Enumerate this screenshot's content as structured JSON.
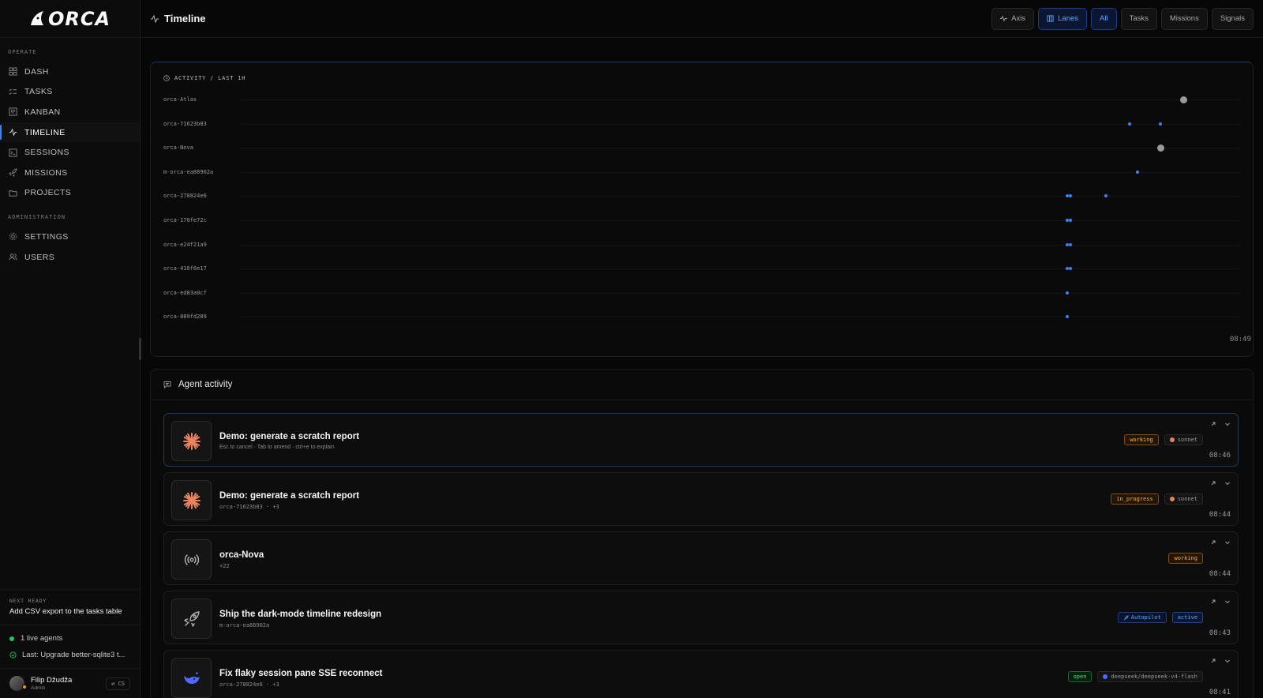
{
  "brand": {
    "logo_text": "ORCA",
    "accent": "#3b82f6"
  },
  "sidebar": {
    "sections": [
      {
        "label": "OPERATE",
        "items": [
          {
            "label": "DASH",
            "icon": "grid-icon"
          },
          {
            "label": "TASKS",
            "icon": "checklist-icon"
          },
          {
            "label": "KANBAN",
            "icon": "kanban-icon"
          },
          {
            "label": "TIMELINE",
            "icon": "activity-icon",
            "active": true
          },
          {
            "label": "SESSIONS",
            "icon": "terminal-icon"
          },
          {
            "label": "MISSIONS",
            "icon": "rocket-icon"
          },
          {
            "label": "PROJECTS",
            "icon": "folder-icon"
          }
        ]
      },
      {
        "label": "ADMINISTRATION",
        "items": [
          {
            "label": "SETTINGS",
            "icon": "gear-icon"
          },
          {
            "label": "USERS",
            "icon": "users-icon"
          }
        ]
      }
    ],
    "next_ready": {
      "label": "NEXT READY",
      "title": "Add CSV export to the tasks table"
    },
    "status": {
      "live_agents": "1 live agents",
      "last": "Last: Upgrade better-sqlite3 t..."
    },
    "user": {
      "name": "Filip Džudža",
      "role": "Admin",
      "lang": "CS"
    }
  },
  "header": {
    "title": "Timeline",
    "toolbar": [
      {
        "label": "Axis",
        "icon": "activity-icon",
        "active": false
      },
      {
        "label": "Lanes",
        "icon": "columns-icon",
        "active": true
      },
      {
        "label": "All",
        "active": true
      },
      {
        "label": "Tasks",
        "active": false
      },
      {
        "label": "Missions",
        "active": false
      },
      {
        "label": "Signals",
        "active": false
      }
    ]
  },
  "activity": {
    "title": "ACTIVITY / LAST 1H",
    "end_time": "08:49",
    "lanes": [
      {
        "name": "orca-Atlas",
        "events": [
          {
            "t": 0.942,
            "big": true
          }
        ]
      },
      {
        "name": "orca-71623b83",
        "events": [
          {
            "t": 0.888
          },
          {
            "t": 0.919
          }
        ]
      },
      {
        "name": "orca-Nova",
        "events": [
          {
            "t": 0.919,
            "big": true
          }
        ]
      },
      {
        "name": "m-orca-ea88902a",
        "events": [
          {
            "t": 0.896
          }
        ]
      },
      {
        "name": "orca-278824e6",
        "events": [
          {
            "t": 0.826
          },
          {
            "t": 0.829
          },
          {
            "t": 0.864
          }
        ]
      },
      {
        "name": "orca-170fe72c",
        "events": [
          {
            "t": 0.826
          },
          {
            "t": 0.829
          }
        ]
      },
      {
        "name": "orca-e24f21a9",
        "events": [
          {
            "t": 0.826
          },
          {
            "t": 0.829
          }
        ]
      },
      {
        "name": "orca-410f6e17",
        "events": [
          {
            "t": 0.826
          },
          {
            "t": 0.829
          }
        ]
      },
      {
        "name": "orca-ed83a0cf",
        "events": [
          {
            "t": 0.826
          }
        ]
      },
      {
        "name": "orca-889fd289",
        "events": [
          {
            "t": 0.826
          }
        ]
      }
    ]
  },
  "agent_activity": {
    "title": "Agent activity",
    "cards": [
      {
        "title": "Demo: generate a scratch report",
        "subtitle": "Esc to cancel · Tab to amend · ctrl+e to explain",
        "icon": "claude-burst-icon",
        "status": "working",
        "status_kind": "working",
        "model": "sonnet",
        "time": "08:46",
        "highlight": true
      },
      {
        "title": "Demo: generate a scratch report",
        "subtitle": "orca-71623b83 · +3",
        "icon": "claude-burst-icon",
        "status": "in_progress",
        "status_kind": "working",
        "model": "sonnet",
        "time": "08:44"
      },
      {
        "title": "orca-Nova",
        "subtitle": "+22",
        "icon": "broadcast-icon",
        "status": "working",
        "status_kind": "working",
        "time": "08:44"
      },
      {
        "title": "Ship the dark-mode timeline redesign",
        "subtitle": "m-orca-ea88902a",
        "icon": "rocket-icon",
        "tag": "Autopilot",
        "status": "active",
        "status_kind": "active",
        "time": "08:43"
      },
      {
        "title": "Fix flaky session pane SSE reconnect",
        "subtitle": "orca-278824e6 · +3",
        "icon": "deepseek-whale-icon",
        "status": "open",
        "status_kind": "open",
        "model": "deepseek/deepseek-v4-flash",
        "time": "08:41"
      }
    ]
  }
}
